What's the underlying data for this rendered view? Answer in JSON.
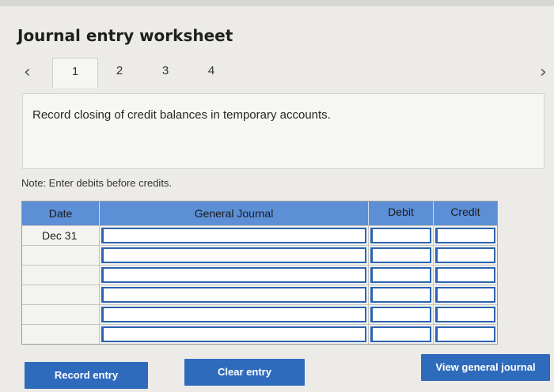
{
  "title": "Journal entry worksheet",
  "tabs": [
    "1",
    "2",
    "3",
    "4"
  ],
  "active_tab_index": 0,
  "prompt": "Record closing of credit balances in temporary accounts.",
  "note": "Note: Enter debits before credits.",
  "table": {
    "headers": {
      "date": "Date",
      "general_journal": "General Journal",
      "debit": "Debit",
      "credit": "Credit"
    },
    "rows": [
      {
        "date": "Dec 31",
        "general_journal": "",
        "debit": "",
        "credit": ""
      },
      {
        "date": "",
        "general_journal": "",
        "debit": "",
        "credit": ""
      },
      {
        "date": "",
        "general_journal": "",
        "debit": "",
        "credit": ""
      },
      {
        "date": "",
        "general_journal": "",
        "debit": "",
        "credit": ""
      },
      {
        "date": "",
        "general_journal": "",
        "debit": "",
        "credit": ""
      },
      {
        "date": "",
        "general_journal": "",
        "debit": "",
        "credit": ""
      }
    ]
  },
  "buttons": {
    "record": "Record entry",
    "clear": "Clear entry",
    "view": "View general journal"
  },
  "icons": {
    "prev": "chevron-left-icon",
    "next": "chevron-right-icon"
  },
  "colors": {
    "header_bg": "#5d8fd6",
    "button_bg": "#2f6bbd",
    "input_border": "#2c63b0"
  }
}
